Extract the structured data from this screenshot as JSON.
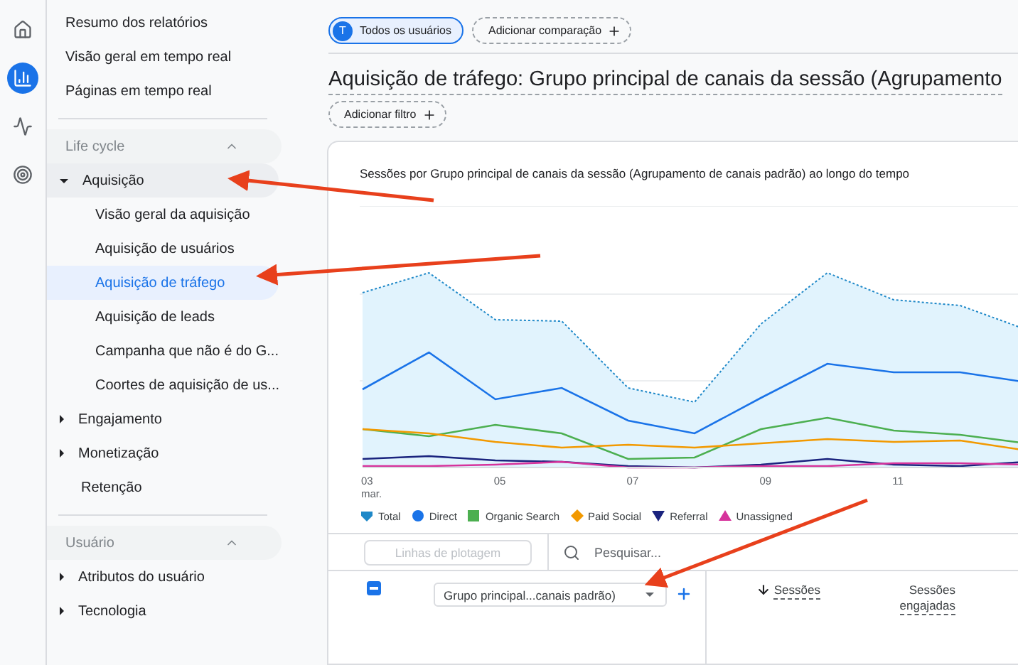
{
  "rail": [
    {
      "kind": "home",
      "selected": false
    },
    {
      "kind": "reports",
      "selected": true
    },
    {
      "kind": "explore",
      "selected": false
    },
    {
      "kind": "advertising",
      "selected": false
    }
  ],
  "sidebar": {
    "top_links": [
      "Resumo dos relatórios",
      "Visão geral em tempo real",
      "Páginas em tempo real"
    ],
    "sections": [
      {
        "title": "Life cycle",
        "expanded": true,
        "items": [
          {
            "label": "Aquisição",
            "expandable": true,
            "expanded": true,
            "selected": false,
            "children": [
              {
                "label": "Visão geral da aquisição",
                "selected": false
              },
              {
                "label": "Aquisição de usuários",
                "selected": false
              },
              {
                "label": "Aquisição de tráfego",
                "selected": true
              },
              {
                "label": "Aquisição de leads",
                "selected": false
              },
              {
                "label": "Campanha que não é do G...",
                "selected": false
              },
              {
                "label": "Coortes de aquisição de us...",
                "selected": false
              }
            ]
          },
          {
            "label": "Engajamento",
            "expandable": true,
            "expanded": false,
            "selected": false
          },
          {
            "label": "Monetização",
            "expandable": true,
            "expanded": false,
            "selected": false
          },
          {
            "label": "Retenção",
            "expandable": false,
            "expanded": false,
            "selected": false
          }
        ]
      },
      {
        "title": "Usuário",
        "expanded": true,
        "items": [
          {
            "label": "Atributos do usuário",
            "expandable": true,
            "expanded": false,
            "selected": false
          },
          {
            "label": "Tecnologia",
            "expandable": true,
            "expanded": false,
            "selected": false
          }
        ]
      }
    ]
  },
  "segments": [
    {
      "initial": "T",
      "label": "Todos os usuários"
    }
  ],
  "add_comparison": "Adicionar comparação",
  "title": "Aquisição de tráfego: Grupo principal de canais da sessão (Agrupamento",
  "add_filter": "Adicionar filtro",
  "card": {
    "title": "Sessões por Grupo principal de canais da sessão (Agrupamento de canais padrão) ao longo do tempo",
    "x_labels": [
      {
        "day": "03",
        "month": "mar."
      },
      {
        "day": "05"
      },
      {
        "day": "07"
      },
      {
        "day": "09"
      },
      {
        "day": "11"
      }
    ],
    "legend": [
      {
        "label": "Total",
        "color": "#1e88c8"
      },
      {
        "label": "Direct",
        "color": "#1a73e8"
      },
      {
        "label": "Organic Search",
        "color": "#4caf50"
      },
      {
        "label": "Paid Social",
        "color": "#f29900"
      },
      {
        "label": "Referral",
        "color": "#1a237e"
      },
      {
        "label": "Unassigned",
        "color": "#d6339c"
      }
    ]
  },
  "table": {
    "select_all": {
      "indeterminate": true
    },
    "plot_rows": {
      "label": "Linhas de plotagem",
      "disabled": true
    },
    "search": {
      "placeholder": "Pesquisar..."
    },
    "dimension": "Grupo principal...canais padrão)",
    "columns": [
      {
        "label": "Sessões",
        "sorted": true
      },
      {
        "label": "Sessões engajadas",
        "sorted": false
      }
    ]
  }
}
